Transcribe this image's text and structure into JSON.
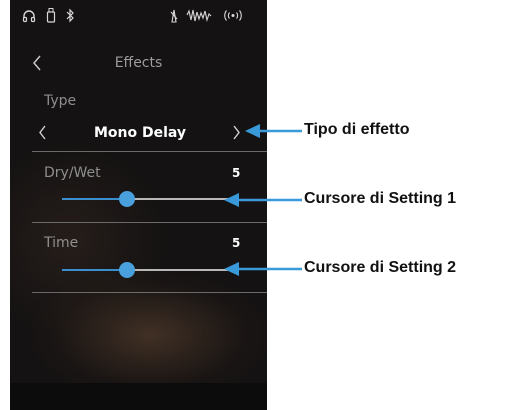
{
  "status_bar": {
    "icons": [
      "headphones-icon",
      "usb-icon",
      "bluetooth-icon",
      "metronome-icon",
      "audio-wave-icon",
      "wireless-icon"
    ]
  },
  "header": {
    "title": "Effects",
    "back_icon": "chevron-left-icon"
  },
  "type_setting": {
    "label": "Type",
    "value": "Mono Delay",
    "prev_icon": "chevron-left-icon",
    "next_icon": "chevron-right-icon"
  },
  "settings": [
    {
      "label": "Dry/Wet",
      "value": "5",
      "fill": 0.38
    },
    {
      "label": "Time",
      "value": "5",
      "fill": 0.38
    }
  ],
  "callouts": {
    "effect_type": "Tipo di effetto",
    "setting1": "Cursore di Setting 1",
    "setting2": "Cursore di Setting 2"
  },
  "colors": {
    "accent": "#4aa0dc",
    "background": "#141212",
    "callout_arrow": "#3a9ad9"
  }
}
